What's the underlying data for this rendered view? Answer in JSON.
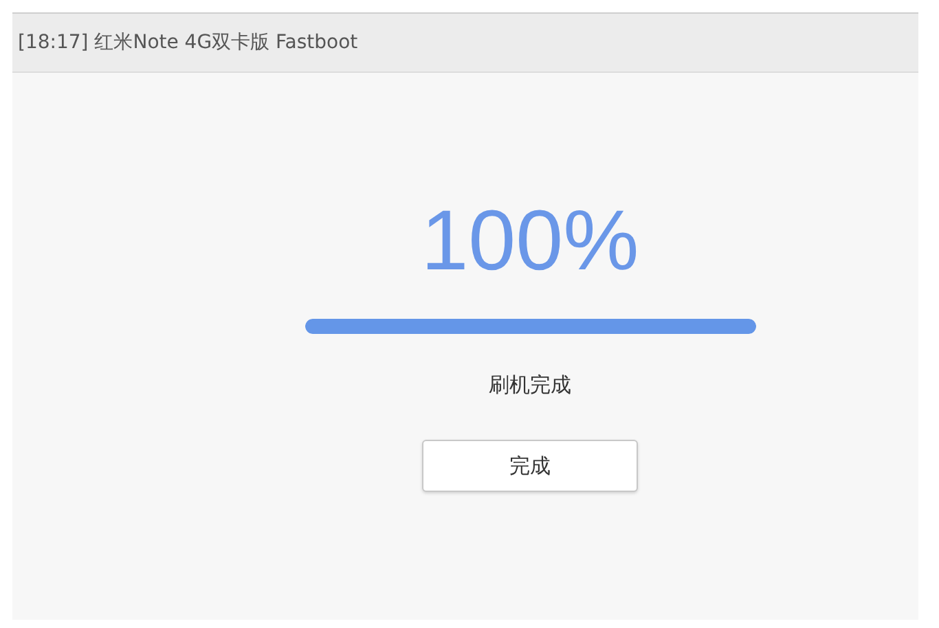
{
  "window": {
    "title": "[18:17] 红米Note 4G双卡版 Fastboot"
  },
  "progress": {
    "percent": "100%",
    "level": 1
  },
  "status": "刷机完成",
  "button": "完成"
}
